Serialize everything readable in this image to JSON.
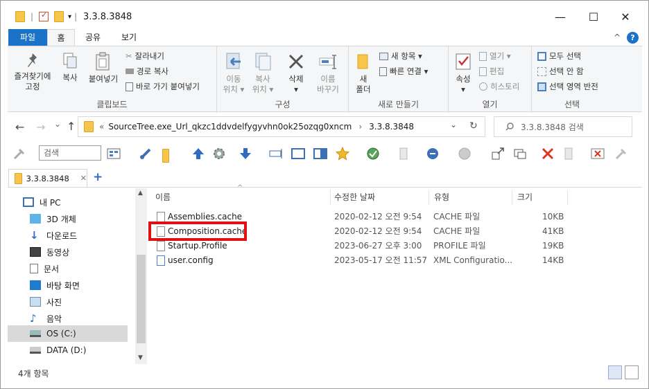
{
  "window": {
    "title": "3.3.8.3848",
    "minimize": "—",
    "maximize": "☐",
    "close": "✕",
    "qa_separator": "|",
    "qa_dropdown": "▾"
  },
  "ribbon_tabs": [
    "파일",
    "홈",
    "공유",
    "보기"
  ],
  "ribbon_collapse": "^",
  "help": "?",
  "clipboard": {
    "pin": "즐겨찾기에\n고정",
    "copy": "복사",
    "paste": "붙여넣기",
    "cut": "잘라내기",
    "copy_path": "경로 복사",
    "paste_shortcut": "바로 가기 붙여넣기",
    "label": "클립보드"
  },
  "organize": {
    "move": "이동\n위치 ▾",
    "copy_to": "복사\n위치 ▾",
    "delete": "삭제\n▾",
    "rename": "이름\n바꾸기",
    "label": "구성"
  },
  "new": {
    "new_folder": "새\n폴더",
    "new_item": "새 항목 ▾",
    "easy_access": "빠른 연결 ▾",
    "label": "새로 만들기"
  },
  "open": {
    "properties": "속성\n▾",
    "open": "열기 ▾",
    "edit": "편집",
    "history": "히스토리",
    "label": "열기"
  },
  "select": {
    "select_all": "모두 선택",
    "select_none": "선택 안 함",
    "invert": "선택 영역 반전",
    "label": "선택"
  },
  "address": {
    "prefix": "«",
    "path1": "SourceTree.exe_Url_qkzc1ddvdelfygyvhn0ok25ozqg0xncm",
    "sep": "›",
    "path2": "3.3.8.3848",
    "dropdown": "⌄",
    "refresh": "↻",
    "search_placeholder": "3.3.8.3848 검색"
  },
  "nav_buttons": {
    "back": "←",
    "forward": "→",
    "recent": "⌄",
    "up": "↑"
  },
  "toolbar": {
    "search_label": "검색"
  },
  "folder_tab": {
    "label": "3.3.8.3848",
    "close": "✕",
    "add": "+"
  },
  "nav_pane": [
    {
      "label": "내 PC",
      "icon": "pc-icon"
    },
    {
      "label": "3D 개체",
      "icon": "3d-objects-icon"
    },
    {
      "label": "다운로드",
      "icon": "download-icon"
    },
    {
      "label": "동영상",
      "icon": "video-icon"
    },
    {
      "label": "문서",
      "icon": "document-icon"
    },
    {
      "label": "바탕 화면",
      "icon": "desktop-icon"
    },
    {
      "label": "사진",
      "icon": "picture-icon"
    },
    {
      "label": "음악",
      "icon": "music-icon"
    },
    {
      "label": "OS (C:)",
      "icon": "drive-icon"
    },
    {
      "label": "DATA (D:)",
      "icon": "drive-icon"
    }
  ],
  "columns": {
    "name": "이름",
    "modified": "수정한 날짜",
    "type": "유형",
    "size": "크기"
  },
  "files": [
    {
      "name": "Assemblies.cache",
      "modified": "2020-02-12 오전 9:54",
      "type": "CACHE 파일",
      "size": "10KB"
    },
    {
      "name": "Composition.cache",
      "modified": "2020-02-12 오전 9:54",
      "type": "CACHE 파일",
      "size": "41KB"
    },
    {
      "name": "Startup.Profile",
      "modified": "2023-06-27 오후 3:00",
      "type": "PROFILE 파일",
      "size": "19KB"
    },
    {
      "name": "user.config",
      "modified": "2023-05-17 오전 11:57",
      "type": "XML Configuratio...",
      "size": "14KB"
    }
  ],
  "status": {
    "count": "4개 항목"
  },
  "colors": {
    "accent": "#1a73c8",
    "highlight": "#e01010",
    "folder": "#f6c54a"
  }
}
